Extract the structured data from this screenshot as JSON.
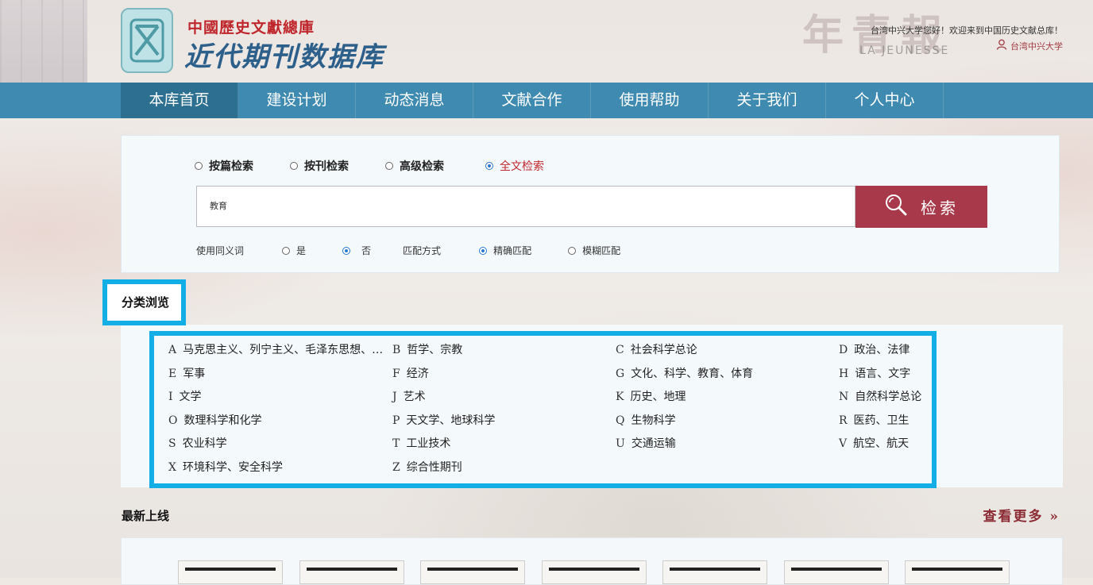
{
  "header": {
    "logo_title": "中國歷史文獻總庫",
    "logo_subtitle": "近代期刊数据库",
    "welcome": "台湾中兴大学您好！欢迎来到中国历史文献总库！",
    "user": "台湾中兴大学"
  },
  "background": {
    "right_text": "年青報",
    "jeunesse": "LA JEUNESSE"
  },
  "nav": {
    "items": [
      {
        "label": "本库首页"
      },
      {
        "label": "建设计划"
      },
      {
        "label": "动态消息"
      },
      {
        "label": "文献合作"
      },
      {
        "label": "使用帮助"
      },
      {
        "label": "关于我们"
      },
      {
        "label": "个人中心"
      }
    ],
    "active": "本库首页"
  },
  "search": {
    "modes": [
      {
        "label": "按篇检索",
        "selected": false
      },
      {
        "label": "按刊检索",
        "selected": false
      },
      {
        "label": "高级检索",
        "selected": false
      },
      {
        "label": "全文检索",
        "selected": true
      }
    ],
    "query": "教育",
    "button_label": "检索",
    "synonym_label": "使用同义词",
    "synonym_yes": "是",
    "synonym_no": "否",
    "synonym_selected": "否",
    "match_label": "匹配方式",
    "match_exact": "精确匹配",
    "match_fuzzy": "模糊匹配",
    "match_selected": "精确匹配"
  },
  "categories": {
    "title": "分类浏览",
    "items": [
      {
        "code": "A",
        "label": "马克思主义、列宁主义、毛泽东思想、…"
      },
      {
        "code": "B",
        "label": "哲学、宗教"
      },
      {
        "code": "C",
        "label": "社会科学总论"
      },
      {
        "code": "D",
        "label": "政治、法律"
      },
      {
        "code": "E",
        "label": "军事"
      },
      {
        "code": "F",
        "label": "经济"
      },
      {
        "code": "G",
        "label": "文化、科学、教育、体育"
      },
      {
        "code": "H",
        "label": "语言、文字"
      },
      {
        "code": "I",
        "label": "文学"
      },
      {
        "code": "J",
        "label": "艺术"
      },
      {
        "code": "K",
        "label": "历史、地理"
      },
      {
        "code": "N",
        "label": "自然科学总论"
      },
      {
        "code": "O",
        "label": "数理科学和化学"
      },
      {
        "code": "P",
        "label": "天文学、地球科学"
      },
      {
        "code": "Q",
        "label": "生物科学"
      },
      {
        "code": "R",
        "label": "医药、卫生"
      },
      {
        "code": "S",
        "label": "农业科学"
      },
      {
        "code": "T",
        "label": "工业技术"
      },
      {
        "code": "U",
        "label": "交通运输"
      },
      {
        "code": "V",
        "label": "航空、航天"
      },
      {
        "code": "X",
        "label": "环境科学、安全科学"
      },
      {
        "code": "Z",
        "label": "综合性期刊"
      }
    ]
  },
  "newest": {
    "title": "最新上线",
    "more": "查看更多",
    "more_icon": "double-chevron-right",
    "thumbnail_count": 7
  },
  "colors": {
    "nav_bg": "#3f8ab0",
    "nav_active": "#2c6f91",
    "search_button": "#a8394a",
    "highlight": "#13aee6",
    "accent_red": "#c0272d"
  }
}
